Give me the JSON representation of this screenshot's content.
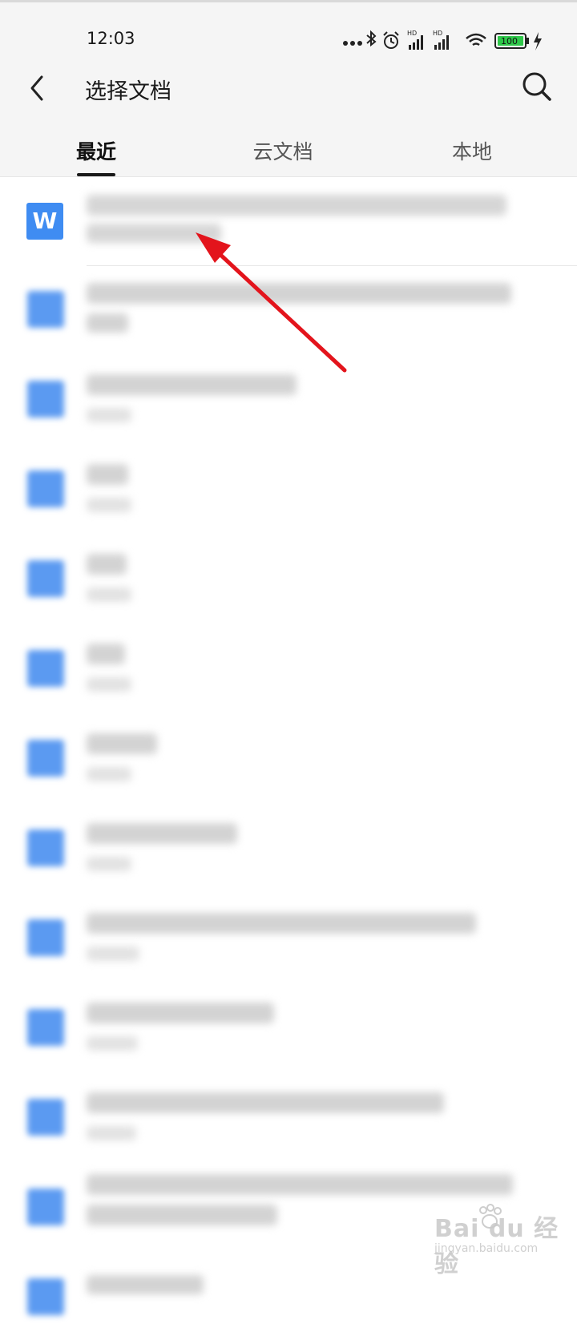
{
  "status_bar": {
    "time": "12:03",
    "battery": "100",
    "icons": [
      "more-dots-icon",
      "bluetooth-icon",
      "alarm-icon",
      "signal-hd-icon",
      "signal-hd-icon",
      "wifi-icon",
      "battery-icon",
      "charging-icon"
    ]
  },
  "header": {
    "title": "选择文档",
    "back_icon": "back-chevron-icon",
    "search_icon": "search-icon"
  },
  "tabs": [
    {
      "label": "最近",
      "active": true
    },
    {
      "label": "云文档",
      "active": false
    },
    {
      "label": "本地",
      "active": false
    }
  ],
  "file_list": [
    {
      "icon": "word-doc-icon",
      "name": "",
      "meta": ""
    },
    {
      "icon": "doc-icon",
      "name": "",
      "meta": ""
    },
    {
      "icon": "doc-icon",
      "name": "",
      "meta": ""
    },
    {
      "icon": "doc-icon",
      "name": "",
      "meta": ""
    },
    {
      "icon": "doc-icon",
      "name": "",
      "meta": ""
    },
    {
      "icon": "doc-icon",
      "name": "",
      "meta": ""
    },
    {
      "icon": "doc-icon",
      "name": "",
      "meta": ""
    },
    {
      "icon": "doc-icon",
      "name": "",
      "meta": ""
    },
    {
      "icon": "doc-icon",
      "name": "",
      "meta": ""
    },
    {
      "icon": "doc-icon",
      "name": "",
      "meta": ""
    },
    {
      "icon": "doc-icon",
      "name": "",
      "meta": ""
    },
    {
      "icon": "doc-icon",
      "name": "",
      "meta": ""
    },
    {
      "icon": "doc-icon",
      "name": "",
      "meta": ""
    }
  ],
  "watermark": {
    "brand": "Bai du 经验",
    "url": "jingyan.baidu.com"
  },
  "colors": {
    "accent_blue": "#3f8cf2",
    "annotation_arrow": "#e3141c",
    "header_bg": "#f5f5f5"
  }
}
